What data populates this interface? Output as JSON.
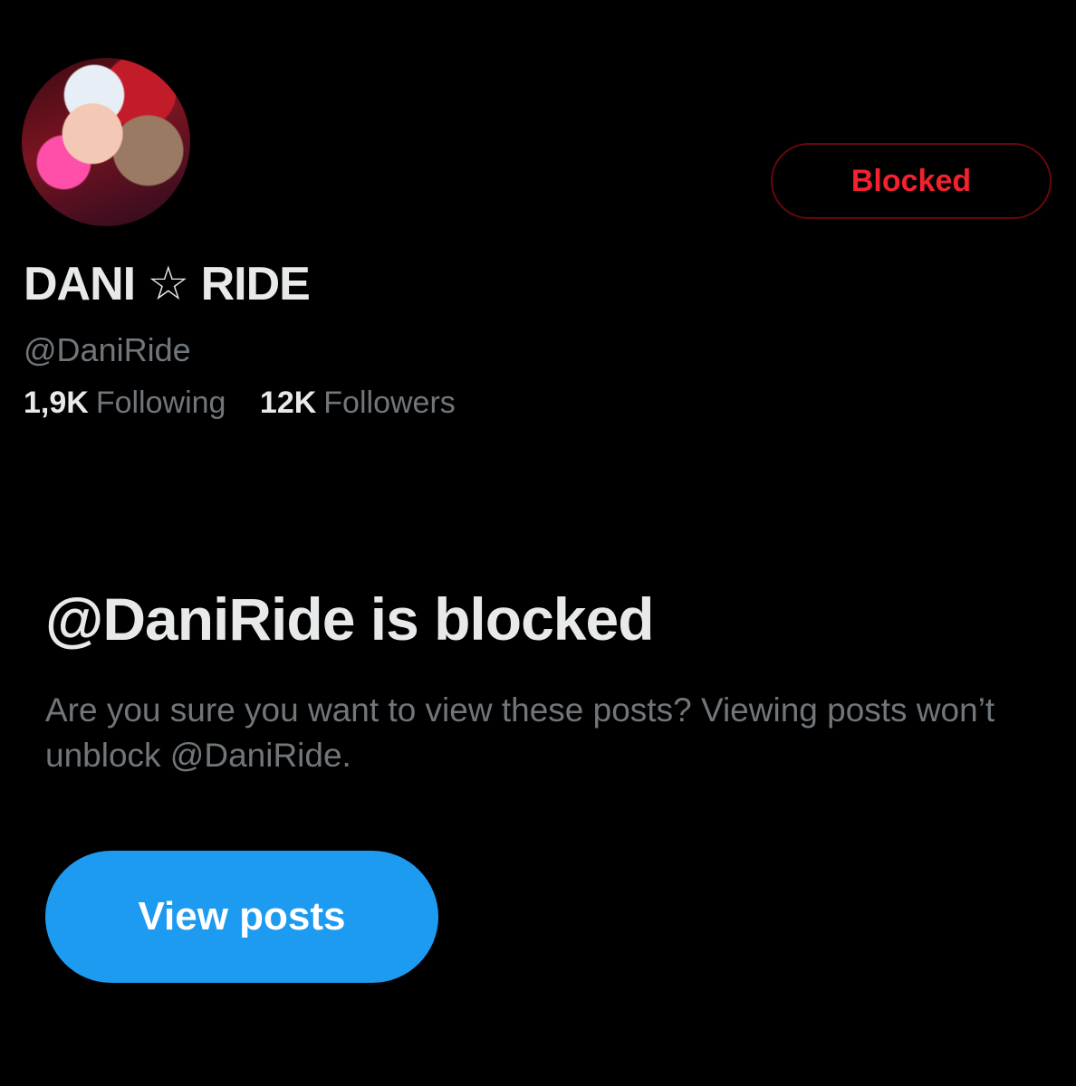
{
  "profile": {
    "display_name": "DANI ☆ RIDE",
    "handle": "@DaniRide",
    "following_count": "1,9K",
    "following_label": "Following",
    "followers_count": "12K",
    "followers_label": "Followers",
    "blocked_button_label": "Blocked"
  },
  "blocked_notice": {
    "title": "@DaniRide is blocked",
    "description": "Are you sure you want to view these posts? Viewing posts won’t unblock @DaniRide.",
    "view_posts_label": "View posts"
  },
  "colors": {
    "background": "#000000",
    "blocked_red": "#f4212e",
    "accent_blue": "#1d9bf0",
    "secondary_text": "#71767b",
    "primary_text": "#e7e9ea"
  }
}
